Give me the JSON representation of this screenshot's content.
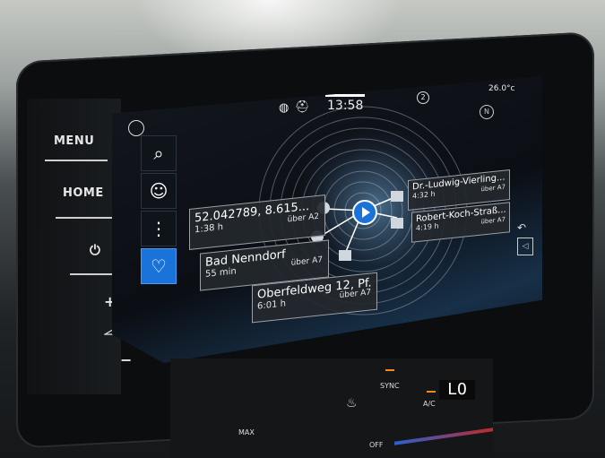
{
  "hardware": {
    "menu_label": "MENU",
    "home_label": "HOME",
    "power_symbol": "⏻",
    "plus_symbol": "+",
    "minus_symbol": "−",
    "volume_icon": "volume-icon"
  },
  "status": {
    "time": "13:58",
    "temperature": "26.0°c",
    "notification_count": "2"
  },
  "destinations": [
    {
      "title": "52.042789, 8.615...",
      "duration": "1:38 h",
      "via": "über A2"
    },
    {
      "title": "Bad Nenndorf",
      "duration": "55 min",
      "via": "über A7"
    },
    {
      "title": "Oberfeldweg 12, Pf...",
      "duration": "6:01 h",
      "via": "über A7"
    },
    {
      "title": "Dr.-Ludwig-Vierling...",
      "duration": "4:32 h",
      "via": "über A7"
    },
    {
      "title": "Robert-Koch-Straß...",
      "duration": "4:19 h",
      "via": "über A7"
    }
  ],
  "climate": {
    "sync_label": "SYNC",
    "ac_label": "A/C",
    "temp_display": "LO",
    "max_label": "MAX",
    "off_label": "OFF"
  },
  "colors": {
    "accent": "#1a73d8",
    "screen_bg": "#0b0e14"
  }
}
